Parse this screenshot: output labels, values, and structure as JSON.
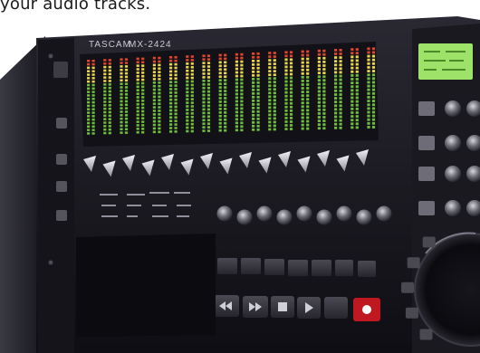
{
  "caption": "your audio tracks.",
  "device": {
    "brand": "TASCAM",
    "model": "MX-2424",
    "channel_count": 18,
    "meter_segments": 22
  },
  "colors": {
    "panel": "#1c1b22",
    "panel_dark": "#0d0c12",
    "meter_green": "#6fbe3a",
    "meter_yellow": "#e9d54a",
    "meter_red": "#e2452c",
    "lcd": "#9fe26a",
    "record": "#d9202a"
  },
  "icons": {
    "transport": [
      "rewind-icon",
      "fast-forward-icon",
      "stop-icon",
      "play-icon",
      "blank-key",
      "record-icon"
    ]
  }
}
